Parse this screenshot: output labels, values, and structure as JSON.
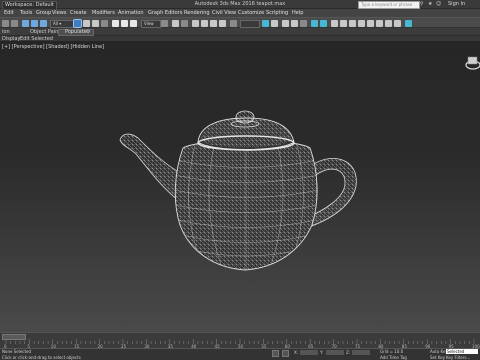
{
  "titlebar": {
    "workspace": "Workspace: Default",
    "title": "Autodesk 3ds Max 2016     teapot.max",
    "search_placeholder": "Type a keyword or phrase",
    "sign_in": "Sign In"
  },
  "menubar": {
    "items": [
      "Edit",
      "Tools",
      "Group",
      "Views",
      "Create",
      "Modifiers",
      "Animation",
      "Graph Editors",
      "Rendering",
      "Civil View",
      "Customize",
      "Scripting",
      "Help"
    ]
  },
  "toolbar": {
    "view_dropdown": "View",
    "selection_set": "Create Selection Se"
  },
  "ribbon": {
    "row1": [
      "ion",
      "Object Paint",
      "Populate"
    ],
    "row2": [
      "Display",
      "Edit Selected"
    ]
  },
  "viewport": {
    "label": "[+] [Perspective] [Shaded] [Hidden Line]"
  },
  "timeline": {
    "frames": [
      "0",
      "5",
      "10",
      "15",
      "20",
      "25",
      "30",
      "35",
      "40",
      "45",
      "50",
      "55",
      "60",
      "65",
      "70",
      "75",
      "80",
      "85",
      "90",
      "95",
      "100"
    ]
  },
  "statusbar": {
    "selected": "None Selected",
    "prompt": "Click or click-and-drag to select objects",
    "auto_key": "Auto Key",
    "selected_field": "Selected",
    "set_key": "Set Key",
    "key_filters": "Key Filters...",
    "add_time_tag": "Add Time Tag",
    "grid": "Grid = 10.0"
  },
  "colors": {
    "accent": "#3d7fc4",
    "wire": "#d8d8d8"
  }
}
